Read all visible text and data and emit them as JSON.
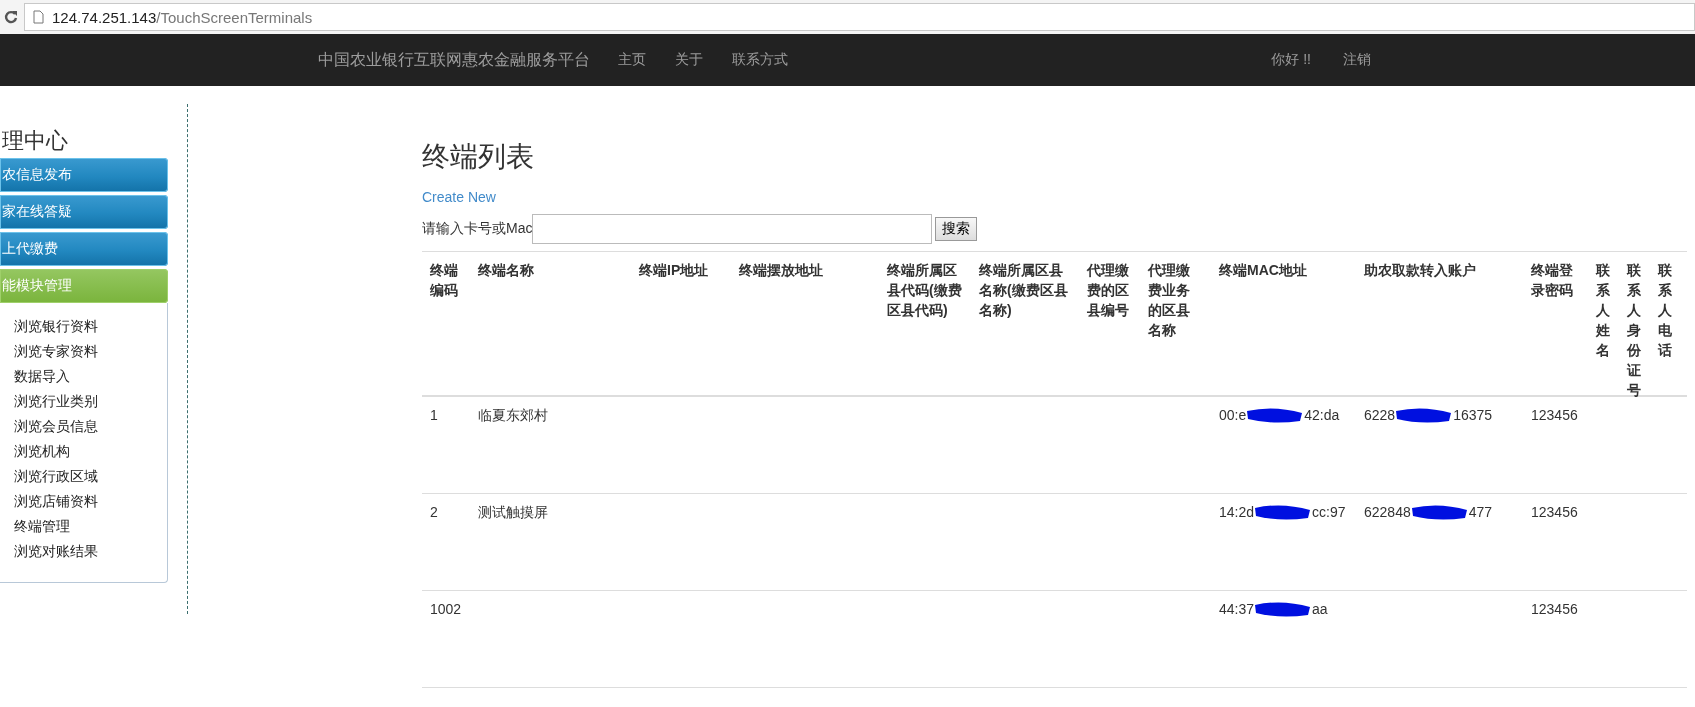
{
  "address_bar": {
    "host": "124.74.251.143",
    "path": "/TouchScreenTerminals"
  },
  "navbar": {
    "brand": "中国农业银行互联网惠农金融服务平台",
    "links": [
      "主页",
      "关于",
      "联系方式"
    ],
    "greeting": "你好 !!",
    "logout": "注销"
  },
  "sidebar": {
    "title": "理中心",
    "sections": [
      {
        "label": "农信息发布",
        "kind": "collapsed"
      },
      {
        "label": "家在线答疑",
        "kind": "collapsed"
      },
      {
        "label": "上代缴费",
        "kind": "collapsed"
      },
      {
        "label": "能模块管理",
        "kind": "expanded"
      }
    ],
    "items": [
      "浏览银行资料",
      "浏览专家资料",
      "数据导入",
      "浏览行业类别",
      "浏览会员信息",
      "浏览机构",
      "浏览行政区域",
      "浏览店铺资料",
      "终端管理",
      "浏览对账结果"
    ]
  },
  "page_title": "终端列表",
  "create_link": "Create New",
  "search": {
    "label": "请输入卡号或Mac",
    "button": "搜索"
  },
  "table": {
    "columns": [
      "终端编码",
      "终端名称",
      "终端IP地址",
      "终端摆放地址",
      "终端所属区县代码(缴费区县代码)",
      "终端所属区县名称(缴费区县名称)",
      "代理缴费的区县编号",
      "代理缴费业务的区县名称",
      "终端MAC地址",
      "助农取款转入账户",
      "终端登录密码",
      "联系人姓名",
      "联系人身份证号",
      "联系人电话"
    ],
    "rows": [
      {
        "code": "1",
        "name": "临夏东郊村",
        "mac": {
          "start": "00:e",
          "end": "42:da"
        },
        "account": {
          "start": "6228",
          "end": "16375"
        },
        "password": "123456"
      },
      {
        "code": "2",
        "name": "测试触摸屏",
        "mac": {
          "start": "14:2d",
          "end": "cc:97"
        },
        "account": {
          "start": "622848",
          "end": "477"
        },
        "password": "123456"
      },
      {
        "code": "1002",
        "mac": {
          "start": "44:37",
          "end": "aa"
        },
        "password": "123456"
      }
    ]
  }
}
